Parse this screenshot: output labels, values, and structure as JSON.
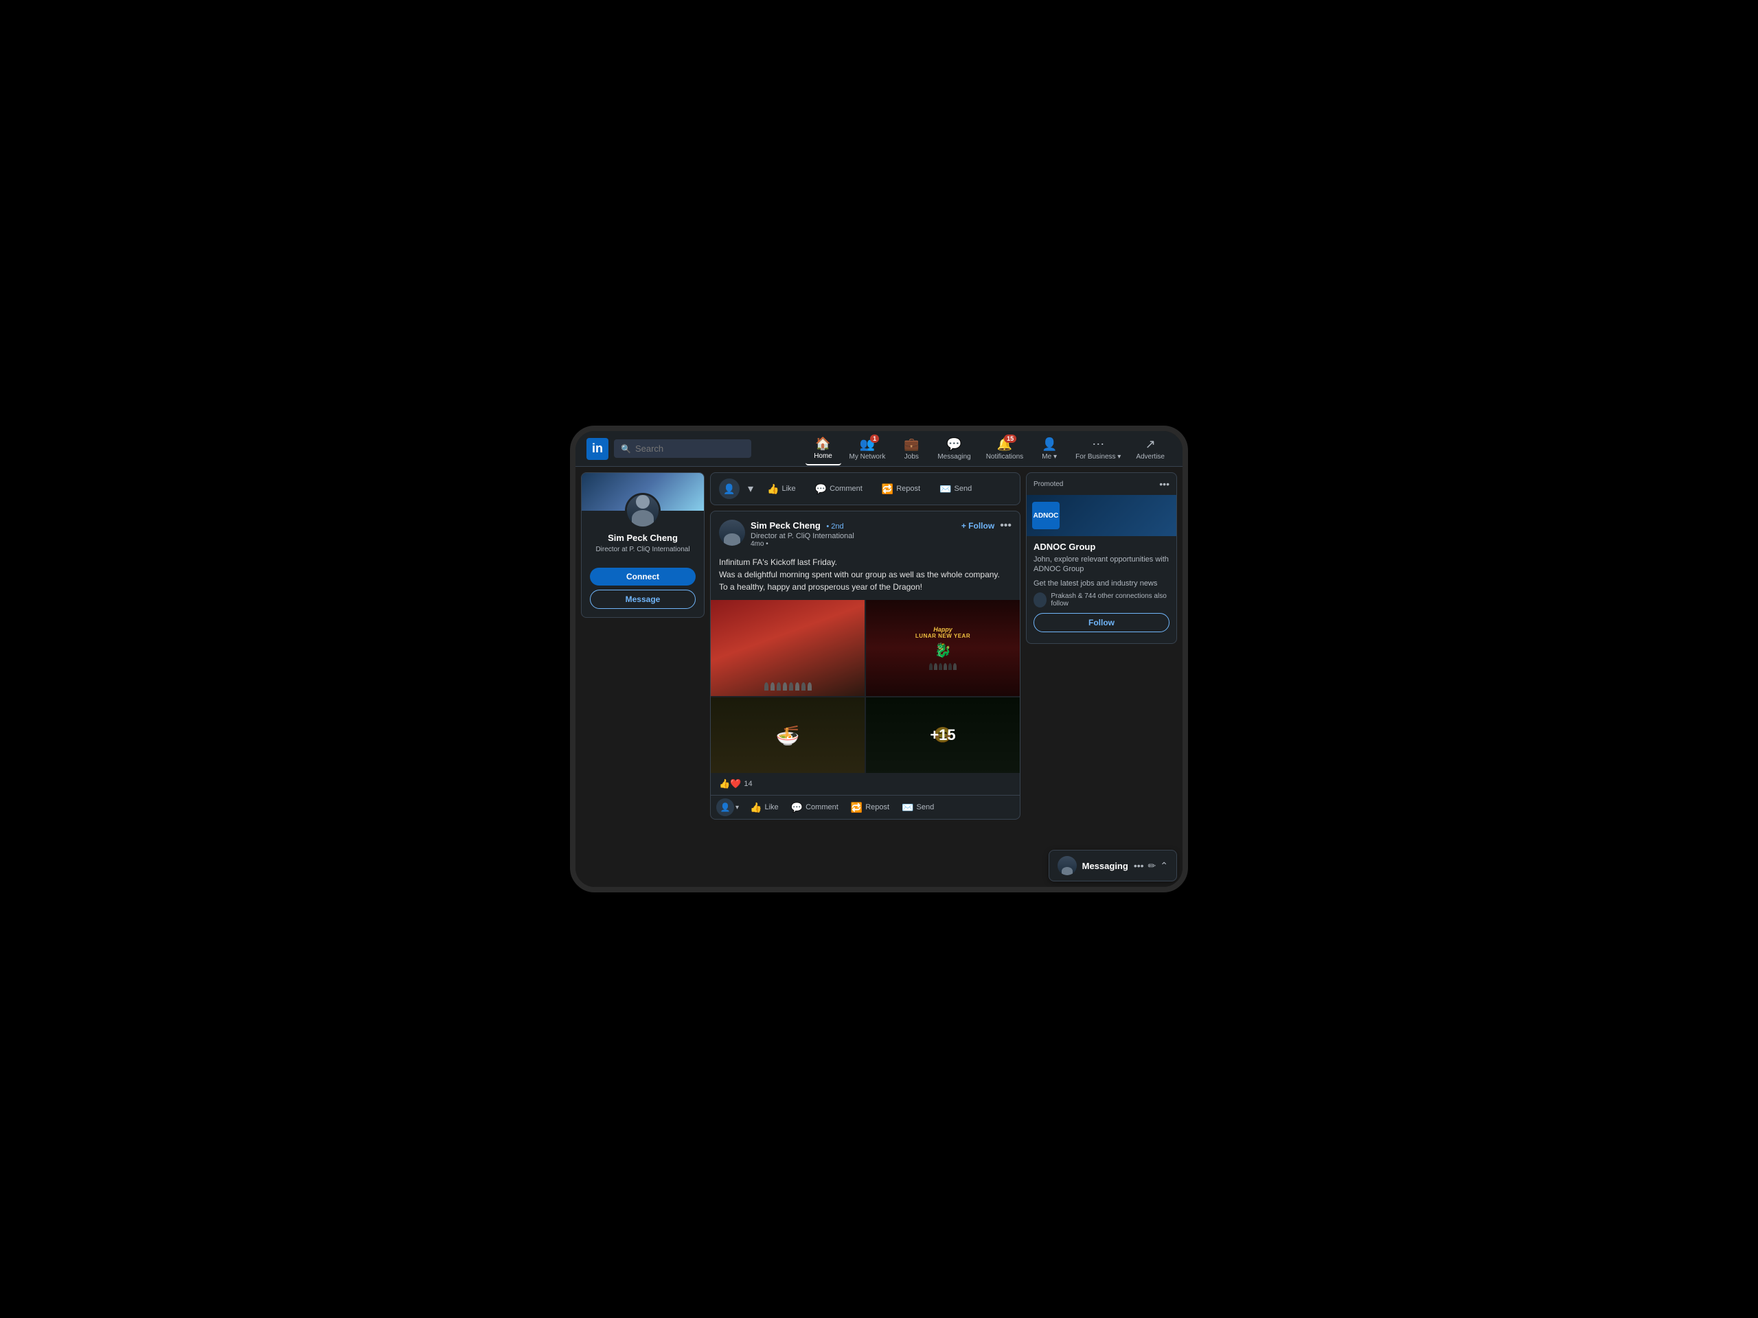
{
  "app": {
    "title": "LinkedIn",
    "logo": "in"
  },
  "navbar": {
    "search_placeholder": "Search",
    "items": [
      {
        "id": "home",
        "label": "Home",
        "icon": "🏠",
        "badge": null,
        "active": true
      },
      {
        "id": "my-network",
        "label": "My Network",
        "icon": "👥",
        "badge": "1",
        "active": false
      },
      {
        "id": "jobs",
        "label": "Jobs",
        "icon": "💼",
        "badge": null,
        "active": false
      },
      {
        "id": "messaging",
        "label": "Messaging",
        "icon": "💬",
        "badge": null,
        "active": false
      },
      {
        "id": "notifications",
        "label": "Notifications",
        "icon": "🔔",
        "badge": "15",
        "active": false
      },
      {
        "id": "me",
        "label": "Me ▾",
        "icon": "👤",
        "badge": null,
        "active": false
      },
      {
        "id": "for-business",
        "label": "For Business ▾",
        "icon": "⋯",
        "badge": null,
        "active": false
      },
      {
        "id": "advertise",
        "label": "Advertise",
        "icon": "↗",
        "badge": null,
        "active": false
      }
    ]
  },
  "left_sidebar": {
    "profile": {
      "name": "Sim Peck Cheng",
      "title": "Director at P. CliQ International",
      "connect_label": "Connect",
      "message_label": "Message"
    }
  },
  "post": {
    "author": {
      "name": "Sim Peck Cheng",
      "degree": "• 2nd",
      "title": "Director at P. CliQ International",
      "time": "4mo •",
      "follow_label": "+ Follow"
    },
    "content": "Infinitum FA's Kickoff last Friday.\nWas a delightful morning spent with our group as well as the whole company.\nTo a healthy, happy and prosperous year of the Dragon!",
    "reactions": {
      "count": "14",
      "icons": "👍❤️"
    },
    "image_overlay": "+15",
    "actions": {
      "like": "Like",
      "comment": "Comment",
      "repost": "Repost",
      "send": "Send"
    }
  },
  "top_action_bar": {
    "like": "Like",
    "comment": "Comment",
    "repost": "Repost",
    "send": "Send"
  },
  "right_sidebar": {
    "ad": {
      "promoted_label": "Promoted",
      "company_name": "ADNOC Group",
      "description": "John, explore relevant opportunities with ADNOC Group",
      "sub_description": "Get the latest jobs and industry news",
      "connection_text": "Prakash & 744 other connections also follow",
      "follow_label": "Follow",
      "logo_text": "ADNOC"
    }
  },
  "messaging": {
    "label": "Messaging"
  }
}
